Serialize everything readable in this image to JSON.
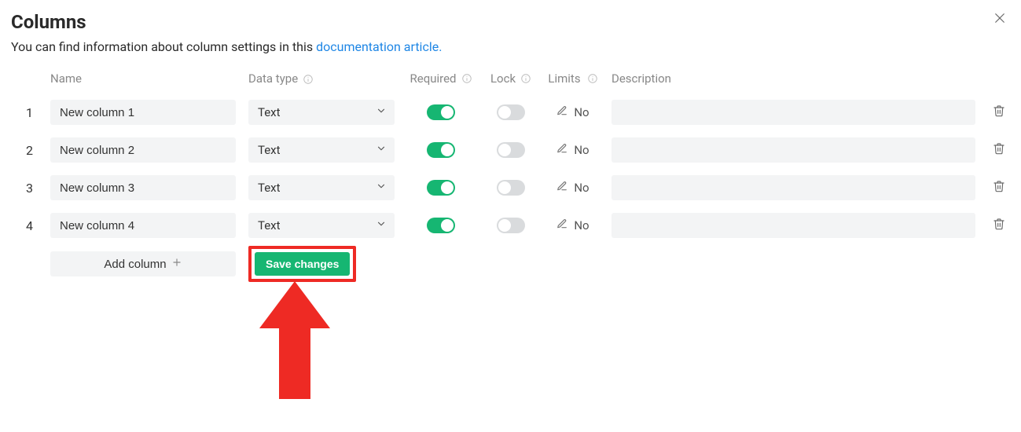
{
  "title": "Columns",
  "subtitle_pre": "You can find information about column settings in this ",
  "subtitle_link": "documentation article.",
  "headers": {
    "name": "Name",
    "datatype": "Data type",
    "required": "Required",
    "lock": "Lock",
    "limits": "Limits",
    "description": "Description"
  },
  "rows": [
    {
      "idx": "1",
      "name": "New column 1",
      "type": "Text",
      "required": true,
      "lock": false,
      "limits": "No",
      "desc": ""
    },
    {
      "idx": "2",
      "name": "New column 2",
      "type": "Text",
      "required": true,
      "lock": false,
      "limits": "No",
      "desc": ""
    },
    {
      "idx": "3",
      "name": "New column 3",
      "type": "Text",
      "required": true,
      "lock": false,
      "limits": "No",
      "desc": ""
    },
    {
      "idx": "4",
      "name": "New column 4",
      "type": "Text",
      "required": true,
      "lock": false,
      "limits": "No",
      "desc": ""
    }
  ],
  "add_label": "Add column",
  "save_label": "Save changes"
}
